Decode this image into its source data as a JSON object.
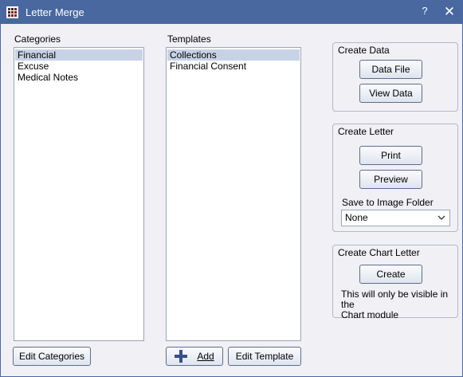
{
  "window": {
    "title": "Letter Merge",
    "help_label": "?",
    "close_label": "✕"
  },
  "categories": {
    "label": "Categories",
    "items": [
      {
        "label": "Financial",
        "selected": true
      },
      {
        "label": "Excuse",
        "selected": false
      },
      {
        "label": "Medical Notes",
        "selected": false
      }
    ],
    "edit_button": "Edit Categories"
  },
  "templates": {
    "label": "Templates",
    "items": [
      {
        "label": "Collections",
        "selected": true
      },
      {
        "label": "Financial Consent",
        "selected": false
      }
    ],
    "add_button": "Add",
    "add_icon": "plus-icon",
    "edit_button": "Edit Template"
  },
  "create_data": {
    "title": "Create Data",
    "data_file_button": "Data File",
    "view_data_button": "View Data"
  },
  "create_letter": {
    "title": "Create Letter",
    "print_button": "Print",
    "preview_button": "Preview",
    "save_label": "Save to Image Folder",
    "save_value": "None"
  },
  "create_chart_letter": {
    "title": "Create Chart Letter",
    "create_button": "Create",
    "note_line1": "This will only be visible in the",
    "note_line2": "Chart module"
  },
  "colors": {
    "titlebar": "#48689f",
    "selection": "#c8d2e6",
    "window_bg": "#f0f0f5"
  }
}
